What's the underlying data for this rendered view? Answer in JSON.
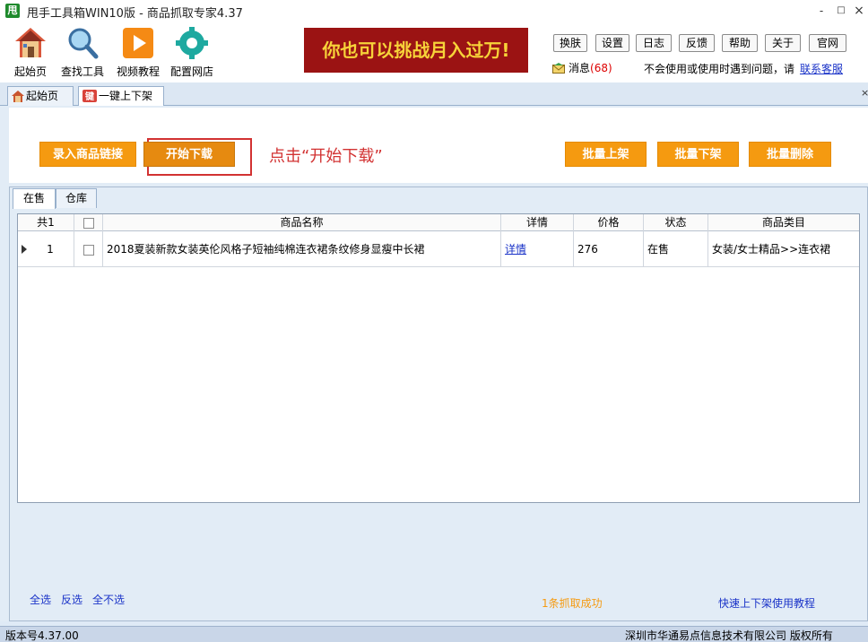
{
  "window": {
    "app_icon": "甩",
    "title": "甩手工具箱WIN10版 - 商品抓取专家4.37",
    "minimize": "-",
    "maximize": "□",
    "close": "×"
  },
  "toolbar": {
    "tools": [
      {
        "label": "起始页",
        "icon": "home-icon"
      },
      {
        "label": "查找工具",
        "icon": "magnifier-icon"
      },
      {
        "label": "视频教程",
        "icon": "play-icon"
      },
      {
        "label": "配置网店",
        "icon": "gear-icon"
      }
    ],
    "banner_text": "你也可以挑战月入过万!",
    "buttons": [
      "换肤",
      "设置",
      "日志",
      "反馈",
      "帮助",
      "关于",
      "官网"
    ],
    "message_label": "消息",
    "message_count": "(68)",
    "help_text": "不会使用或使用时遇到问题，请",
    "contact_link": "联系客服"
  },
  "tabs": [
    {
      "label": "起始页",
      "icon": "home-icon",
      "active": false
    },
    {
      "label": "一键上下架",
      "icon": "app-icon",
      "active": true
    }
  ],
  "tab_close": "×",
  "actions": {
    "import_link": "录入商品链接",
    "start_download": "开始下载",
    "hint": "点击“开始下载”",
    "batch_list": "批量上架",
    "batch_delist": "批量下架",
    "batch_delete": "批量删除"
  },
  "subtabs": [
    "在售",
    "仓库"
  ],
  "grid": {
    "columns": [
      "共1",
      "",
      "商品名称",
      "详情",
      "价格",
      "状态",
      "商品类目"
    ],
    "rows": [
      {
        "index": "1",
        "name": "2018夏装新款女装英伦风格子短袖纯棉连衣裙条纹修身显瘦中长裙",
        "detail": "详情",
        "price": "276",
        "status": "在售",
        "category": "女装/女士精品>>连衣裙"
      }
    ]
  },
  "footer": {
    "select_all": "全选",
    "invert": "反选",
    "select_none": "全不选",
    "success": "1条抓取成功",
    "tutorial": "快速上下架使用教程"
  },
  "statusbar": {
    "version": "版本号4.37.00",
    "copyright": "深圳市华通易点信息技术有限公司 版权所有"
  },
  "colors": {
    "accent_orange": "#f59a10",
    "banner_red": "#9b1313",
    "banner_text": "#f7d339",
    "hint_red": "#d23232",
    "link_blue": "#1a33c8"
  }
}
